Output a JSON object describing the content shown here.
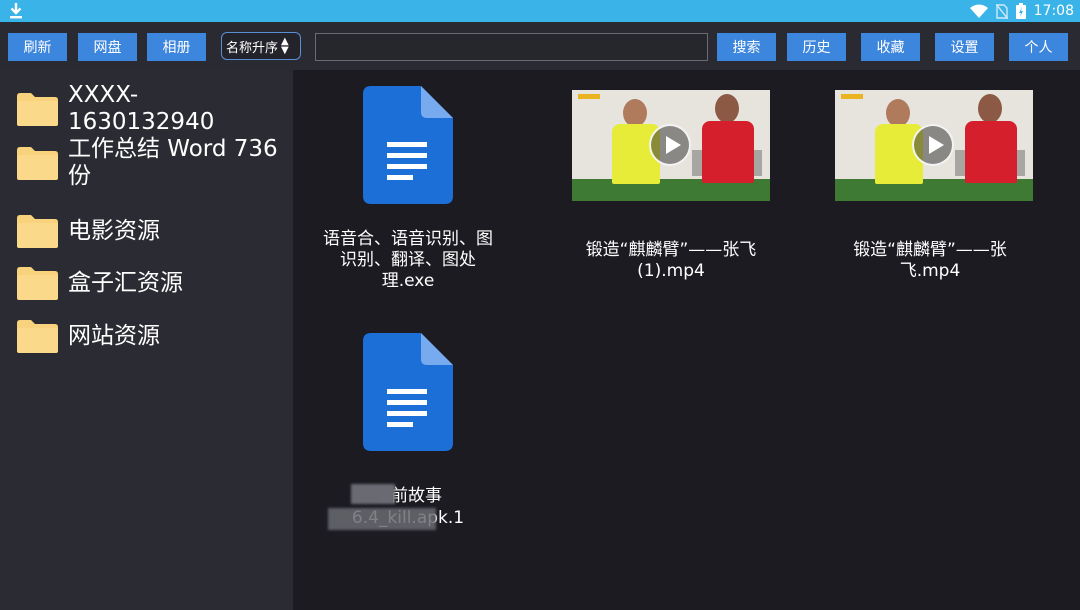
{
  "status_bar": {
    "time": "17:08",
    "icons": [
      "download-icon",
      "wifi-icon",
      "no-sim-icon",
      "battery-icon"
    ]
  },
  "toolbar": {
    "refresh": "刷新",
    "netdisk": "网盘",
    "album": "相册",
    "sort": "名称升序",
    "search_value": "",
    "search": "搜索",
    "history": "历史",
    "favorites": "收藏",
    "settings": "设置",
    "personal": "个人"
  },
  "sidebar": {
    "folders": [
      {
        "label": "XXXX-1630132940"
      },
      {
        "label": "工作总结 Word 736份"
      },
      {
        "label": "电影资源"
      },
      {
        "label": "盒子汇资源"
      },
      {
        "label": "网站资源"
      }
    ]
  },
  "files": [
    {
      "name": "语音合、语音识别、图识别、翻译、图处理.exe",
      "type": "document"
    },
    {
      "name": "锻造“麒麟臂”——张飞(1).mp4",
      "type": "video"
    },
    {
      "name": "锻造“麒麟臂”——张飞.mp4",
      "type": "video"
    },
    {
      "name": "睡前故事",
      "name_line2": "6.4_kill.apk.1",
      "type": "document"
    }
  ],
  "colors": {
    "status_bar": "#3ab4e8",
    "button": "#3d86de",
    "sidebar": "#2b2b33",
    "background": "#1b1b21",
    "folder": "#f8d27c",
    "doc_icon": "#1d6fd8"
  }
}
